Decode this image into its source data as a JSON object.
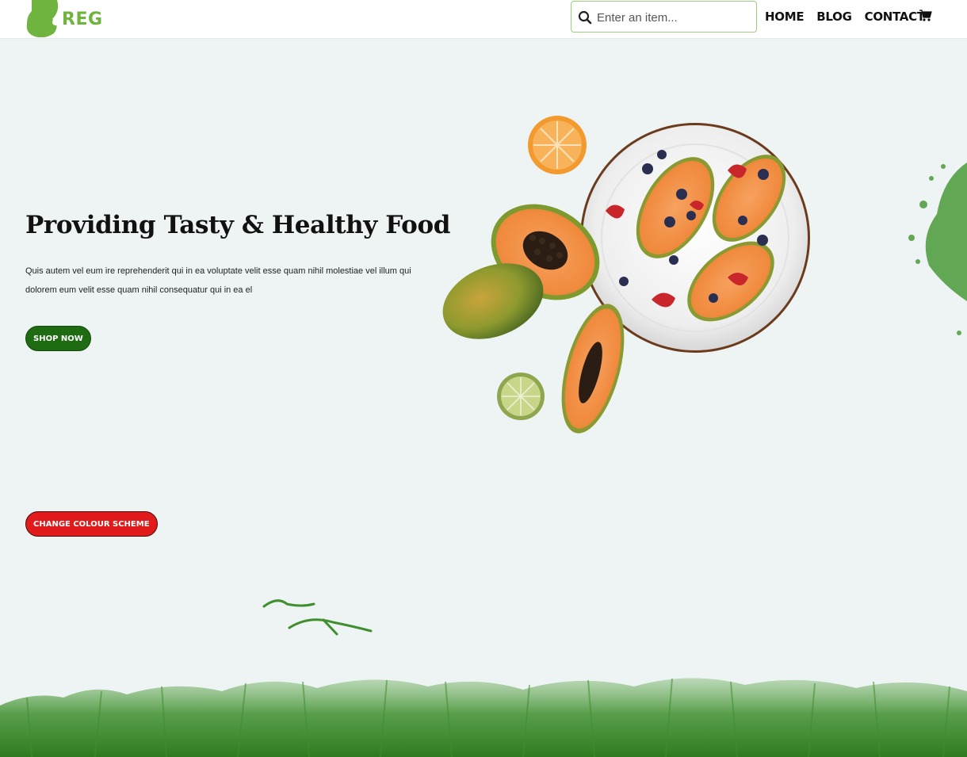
{
  "header": {
    "logo_text": "REG",
    "search_placeholder": "Enter an item...",
    "nav": [
      "HOME",
      "BLOG",
      "CONTACT"
    ]
  },
  "hero": {
    "title": "Providing Tasty & Healthy Food",
    "text": "Quis autem vel eum ire reprehenderit qui in ea voluptate velit esse quam nihil molestiae vel illum qui dolorem eum velit esse quam nihil consequatur qui in ea el",
    "shop_button": "SHOP NOW"
  },
  "scheme_button": "CHANGE COLOUR SCHEME",
  "icons": [
    "search-icon",
    "cart-icon"
  ],
  "colors": {
    "accent_green": "#6fb43f",
    "button_green": "#1e6b12",
    "button_red": "#e11b1b",
    "background": "#eef3f4",
    "grass": "#3f8f2e"
  }
}
